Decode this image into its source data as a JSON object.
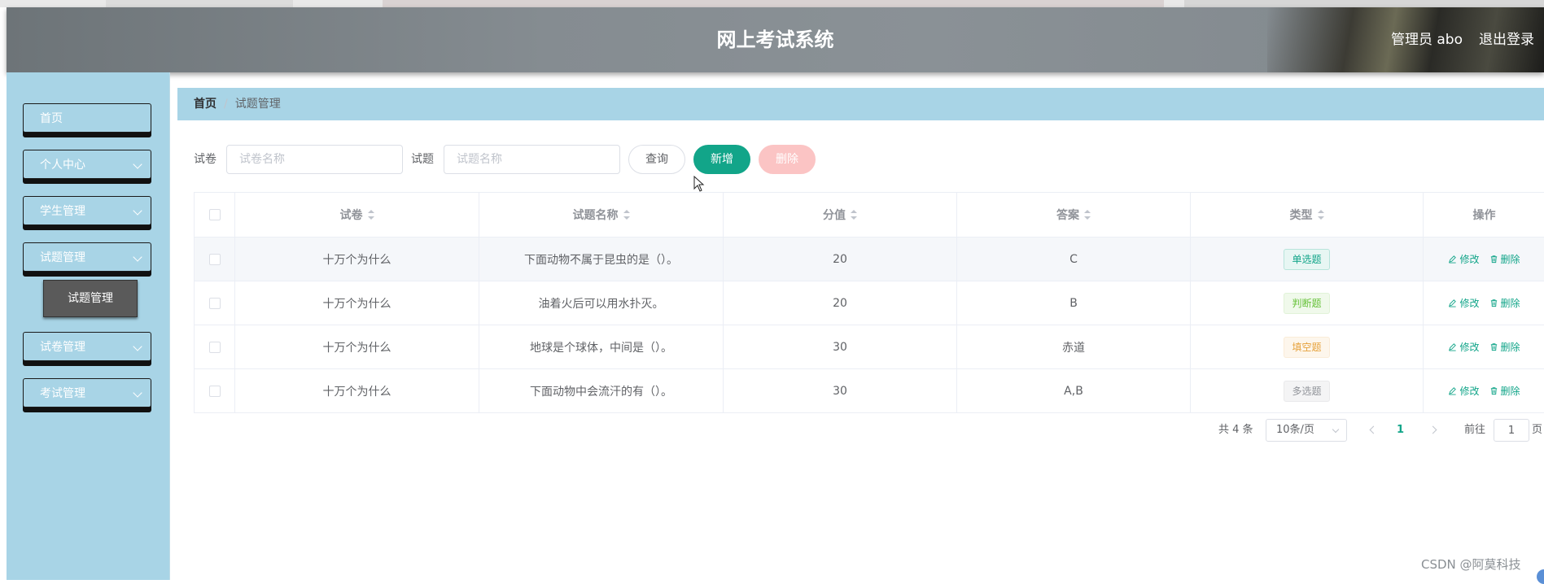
{
  "app": {
    "title": "网上考试系统",
    "user_label": "管理员 abo",
    "logout_label": "退出登录"
  },
  "sidebar": {
    "items": [
      {
        "label": "首页",
        "has_children": false
      },
      {
        "label": "个人中心",
        "has_children": true
      },
      {
        "label": "学生管理",
        "has_children": true
      },
      {
        "label": "试题管理",
        "has_children": true
      },
      {
        "label": "试卷管理",
        "has_children": true
      },
      {
        "label": "考试管理",
        "has_children": true
      }
    ],
    "submenu": {
      "label": "试题管理"
    }
  },
  "breadcrumb": {
    "home": "首页",
    "separator": "/",
    "current": "试题管理"
  },
  "search": {
    "paper_label": "试卷",
    "paper_placeholder": "试卷名称",
    "question_label": "试题",
    "question_placeholder": "试题名称",
    "query_button": "查询",
    "add_button": "新增",
    "delete_button": "删除"
  },
  "table": {
    "columns": [
      "试卷",
      "试题名称",
      "分值",
      "答案",
      "类型",
      "操作"
    ],
    "rows": [
      {
        "paper": "十万个为什么",
        "question": "下面动物不属于昆虫的是（）。",
        "score": "20",
        "answer": "C",
        "type": "单选题",
        "edit": "修改",
        "delete": "删除"
      },
      {
        "paper": "十万个为什么",
        "question": "油着火后可以用水扑灭。",
        "score": "20",
        "answer": "B",
        "type": "判断题",
        "edit": "修改",
        "delete": "删除"
      },
      {
        "paper": "十万个为什么",
        "question": "地球是个球体，中间是（）。",
        "score": "30",
        "answer": "赤道",
        "type": "填空题",
        "edit": "修改",
        "delete": "删除"
      },
      {
        "paper": "十万个为什么",
        "question": "下面动物中会流汗的有（）。",
        "score": "30",
        "answer": "A,B",
        "type": "多选题",
        "edit": "修改",
        "delete": "删除"
      }
    ],
    "type_colors": {
      "单选题": {
        "fg": "#12a589",
        "bg": "#e7f6f3",
        "border": "#b8e4db"
      },
      "判断题": {
        "fg": "#67c23a",
        "bg": "#f0f9eb",
        "border": "#e1f3d8"
      },
      "填空题": {
        "fg": "#e6a23c",
        "bg": "#fdf6ec",
        "border": "#faecd8"
      },
      "多选题": {
        "fg": "#909399",
        "bg": "#f4f4f5",
        "border": "#e9e9eb"
      }
    }
  },
  "pagination": {
    "total_text": "共 4 条",
    "page_size": "10条/页",
    "current_page": "1",
    "goto_label": "前往",
    "goto_value": "1",
    "page_suffix": "页"
  },
  "watermark": "CSDN @阿莫科技",
  "colors": {
    "accent": "#12a589",
    "sidebar_bg": "#a8d4e6",
    "danger_disabled": "#fbc4c4"
  }
}
